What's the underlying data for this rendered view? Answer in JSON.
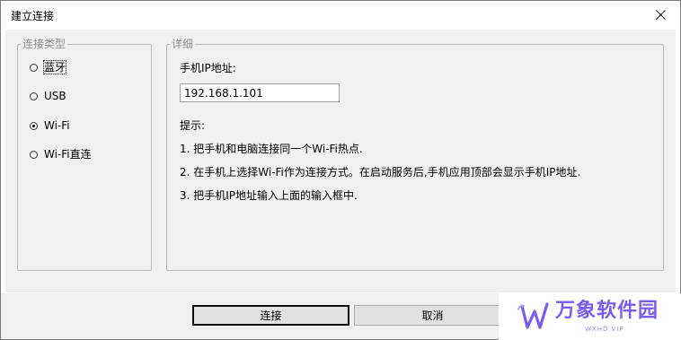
{
  "window": {
    "title": "建立连接"
  },
  "connection_type": {
    "group_label": "连接类型",
    "options": [
      {
        "label": "蓝牙",
        "checked": false
      },
      {
        "label": "USB",
        "checked": false
      },
      {
        "label": "Wi-Fi",
        "checked": true
      },
      {
        "label": "Wi-Fi直连",
        "checked": false
      }
    ]
  },
  "details": {
    "group_label": "详细",
    "ip_label": "手机IP地址:",
    "ip_value": "192.168.1.101",
    "tips_title": "提示:",
    "tips": [
      "1. 把手机和电脑连接同一个Wi-Fi热点.",
      "2. 在手机上选择Wi-Fi作为连接方式。在启动服务后,手机应用顶部会显示手机IP地址.",
      "3. 把手机IP地址输入上面的输入框中."
    ]
  },
  "buttons": {
    "connect": "连接",
    "cancel": "取消"
  },
  "watermark": {
    "text": "万象软件园",
    "sub": "WXHD.VIP"
  },
  "icons": {
    "close": "close-icon",
    "logo": "wanxiang-logo-icon"
  },
  "colors": {
    "dialog_bg": "#f0f0f0",
    "watermark": "#7a5cf0"
  }
}
